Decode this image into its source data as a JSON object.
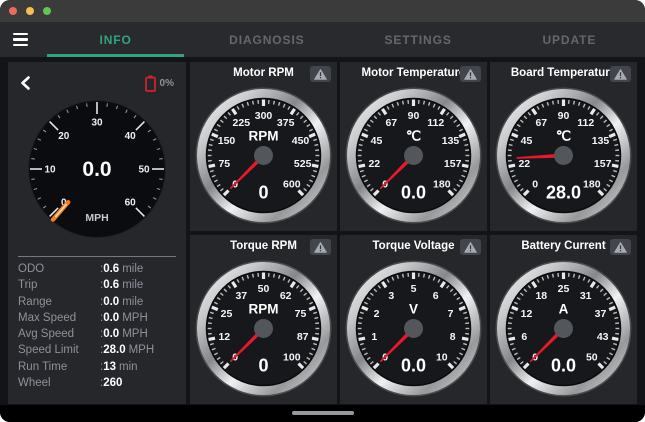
{
  "tabbar": {
    "tabs": [
      {
        "label": "INFO",
        "active": true
      },
      {
        "label": "DIAGNOSIS",
        "active": false
      },
      {
        "label": "SETTINGS",
        "active": false
      },
      {
        "label": "UPDATE",
        "active": false
      }
    ]
  },
  "left_panel": {
    "battery": {
      "percent": "0%"
    },
    "speedometer": {
      "type": "gauge",
      "unit": "MPH",
      "min": 0,
      "max": 60,
      "labels": [
        0,
        10,
        20,
        30,
        40,
        50,
        60
      ],
      "value": 0,
      "value_display": "0.0"
    },
    "stats": [
      {
        "label": "ODO",
        "value": "0.6",
        "unit": "mile"
      },
      {
        "label": "Trip",
        "value": "0.6",
        "unit": "mile"
      },
      {
        "label": "Range",
        "value": "0.0",
        "unit": "mile"
      },
      {
        "label": "Max Speed",
        "value": "0.0",
        "unit": "MPH"
      },
      {
        "label": "Avg Speed",
        "value": "0.0",
        "unit": "MPH"
      },
      {
        "label": "Speed Limit",
        "value": "28.0",
        "unit": "MPH"
      },
      {
        "label": "Run Time",
        "value": "13",
        "unit": "min"
      },
      {
        "label": "Wheel",
        "value": "260",
        "unit": ""
      }
    ]
  },
  "gauges": [
    {
      "title": "Motor RPM",
      "unit": "RPM",
      "min": 0,
      "max": 600,
      "labels": [
        0,
        75,
        150,
        225,
        300,
        375,
        450,
        525,
        600
      ],
      "value": 0,
      "value_display": "0",
      "warning": true
    },
    {
      "title": "Motor Temperature",
      "unit": "℃",
      "min": 0,
      "max": 180,
      "labels": [
        0,
        22,
        45,
        67,
        90,
        112,
        135,
        157,
        180
      ],
      "value": 0,
      "value_display": "0.0",
      "warning": true
    },
    {
      "title": "Board Temperature",
      "unit": "℃",
      "min": 0,
      "max": 180,
      "labels": [
        0,
        22,
        45,
        67,
        90,
        112,
        135,
        157,
        180
      ],
      "value": 28,
      "value_display": "28.0",
      "warning": true
    },
    {
      "title": "Torque RPM",
      "unit": "RPM",
      "min": 0,
      "max": 100,
      "labels": [
        0,
        12,
        25,
        37,
        50,
        62,
        75,
        87,
        100
      ],
      "value": 0,
      "value_display": "0",
      "warning": true
    },
    {
      "title": "Torque Voltage",
      "unit": "V",
      "min": 0,
      "max": 10,
      "labels": [
        0,
        1,
        2,
        3,
        5,
        6,
        7,
        8,
        10
      ],
      "value": 0,
      "value_display": "0.0",
      "warning": true
    },
    {
      "title": "Battery Current",
      "unit": "A",
      "min": 0,
      "max": 50,
      "labels": [
        0,
        6,
        12,
        18,
        25,
        31,
        37,
        43,
        50
      ],
      "value": 0,
      "value_display": "0.0",
      "warning": true
    }
  ],
  "colors": {
    "accent": "#2ea57c",
    "tab_inactive": "#63686e",
    "needle_red": "#e8192a",
    "speed_needle_orange": "#f57c20",
    "battery_red": "#d2232e",
    "traffic_red": "#ed6a5e",
    "traffic_yellow": "#f4bf4f",
    "traffic_green": "#61c454"
  }
}
